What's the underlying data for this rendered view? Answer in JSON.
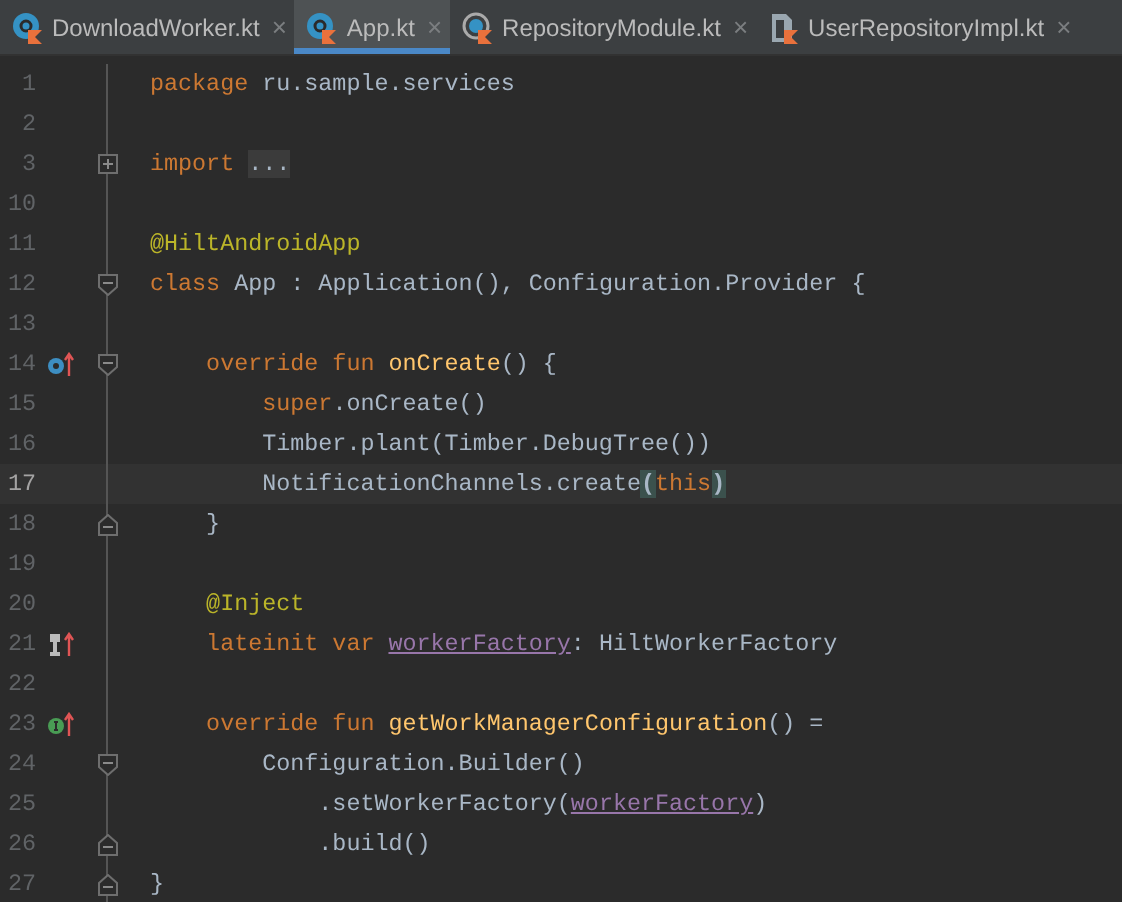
{
  "tabs": [
    {
      "label": "DownloadWorker.kt",
      "close": "×",
      "selected": false
    },
    {
      "label": "App.kt",
      "close": "×",
      "selected": true
    },
    {
      "label": "RepositoryModule.kt",
      "close": "×",
      "selected": false
    },
    {
      "label": "UserRepositoryImpl.kt",
      "close": "×",
      "selected": false
    }
  ],
  "editor": {
    "lines": [
      {
        "number": "1",
        "current": false,
        "tokens": [
          {
            "kind": "keyword",
            "text": "package "
          },
          {
            "kind": "plain",
            "text": "ru.sample.services"
          }
        ]
      },
      {
        "number": "2",
        "current": false
      },
      {
        "number": "3",
        "current": false,
        "fold_marker": {
          "kind": "collapsed"
        },
        "tokens": [
          {
            "kind": "keyword",
            "text": "import "
          },
          {
            "kind": "folded",
            "text": "..."
          }
        ]
      },
      {
        "number": "10",
        "current": false
      },
      {
        "number": "11",
        "current": false,
        "tokens": [
          {
            "kind": "annotation",
            "text": "@HiltAndroidApp"
          }
        ]
      },
      {
        "number": "12",
        "current": false,
        "fold_marker": {
          "kind": "start"
        },
        "tokens": [
          {
            "kind": "keyword",
            "text": "class "
          },
          {
            "kind": "plain",
            "text": "App : Application(), Configuration.Provider {"
          }
        ]
      },
      {
        "number": "13",
        "current": false
      },
      {
        "number": "14",
        "current": false,
        "gutter_marker": {
          "kind": "override"
        },
        "fold_marker": {
          "kind": "start"
        },
        "tokens": [
          {
            "kind": "keyword",
            "text": "    override fun "
          },
          {
            "kind": "function",
            "text": "onCreate"
          },
          {
            "kind": "plain",
            "text": "() {"
          }
        ]
      },
      {
        "number": "15",
        "current": false,
        "tokens": [
          {
            "kind": "keyword",
            "text": "        super"
          },
          {
            "kind": "plain",
            "text": ".onCreate()"
          }
        ]
      },
      {
        "number": "16",
        "current": false,
        "tokens": [
          {
            "kind": "plain",
            "text": "        Timber.plant(Timber.DebugTree())"
          }
        ]
      },
      {
        "number": "17",
        "current": true,
        "tokens": [
          {
            "kind": "plain",
            "text": "        NotificationChannels.create"
          },
          {
            "kind": "brace",
            "text": "("
          },
          {
            "kind": "keyword",
            "text": "this"
          },
          {
            "kind": "brace",
            "text": ")"
          }
        ]
      },
      {
        "number": "18",
        "current": false,
        "fold_marker": {
          "kind": "end"
        },
        "tokens": [
          {
            "kind": "plain",
            "text": "    }"
          }
        ]
      },
      {
        "number": "19",
        "current": false
      },
      {
        "number": "20",
        "current": false,
        "tokens": [
          {
            "kind": "annotation",
            "text": "    @Inject"
          }
        ]
      },
      {
        "number": "21",
        "current": false,
        "gutter_marker": {
          "kind": "injected"
        },
        "tokens": [
          {
            "kind": "keyword",
            "text": "    lateinit var "
          },
          {
            "kind": "property",
            "text": "workerFactory"
          },
          {
            "kind": "plain",
            "text": ": HiltWorkerFactory"
          }
        ]
      },
      {
        "number": "22",
        "current": false
      },
      {
        "number": "23",
        "current": false,
        "gutter_marker": {
          "kind": "implements"
        },
        "tokens": [
          {
            "kind": "keyword",
            "text": "    override fun "
          },
          {
            "kind": "function",
            "text": "getWorkManagerConfiguration"
          },
          {
            "kind": "plain",
            "text": "() ="
          }
        ]
      },
      {
        "number": "24",
        "current": false,
        "fold_marker": {
          "kind": "start"
        },
        "tokens": [
          {
            "kind": "plain",
            "text": "        Configuration.Builder()"
          }
        ]
      },
      {
        "number": "25",
        "current": false,
        "tokens": [
          {
            "kind": "plain",
            "text": "            .setWorkerFactory("
          },
          {
            "kind": "property",
            "text": "workerFactory"
          },
          {
            "kind": "plain",
            "text": ")"
          }
        ]
      },
      {
        "number": "26",
        "current": false,
        "fold_marker": {
          "kind": "end"
        },
        "tokens": [
          {
            "kind": "plain",
            "text": "            .build()"
          }
        ]
      },
      {
        "number": "27",
        "current": false,
        "fold_marker": {
          "kind": "end"
        },
        "tokens": [
          {
            "kind": "plain",
            "text": "}"
          }
        ]
      }
    ]
  }
}
